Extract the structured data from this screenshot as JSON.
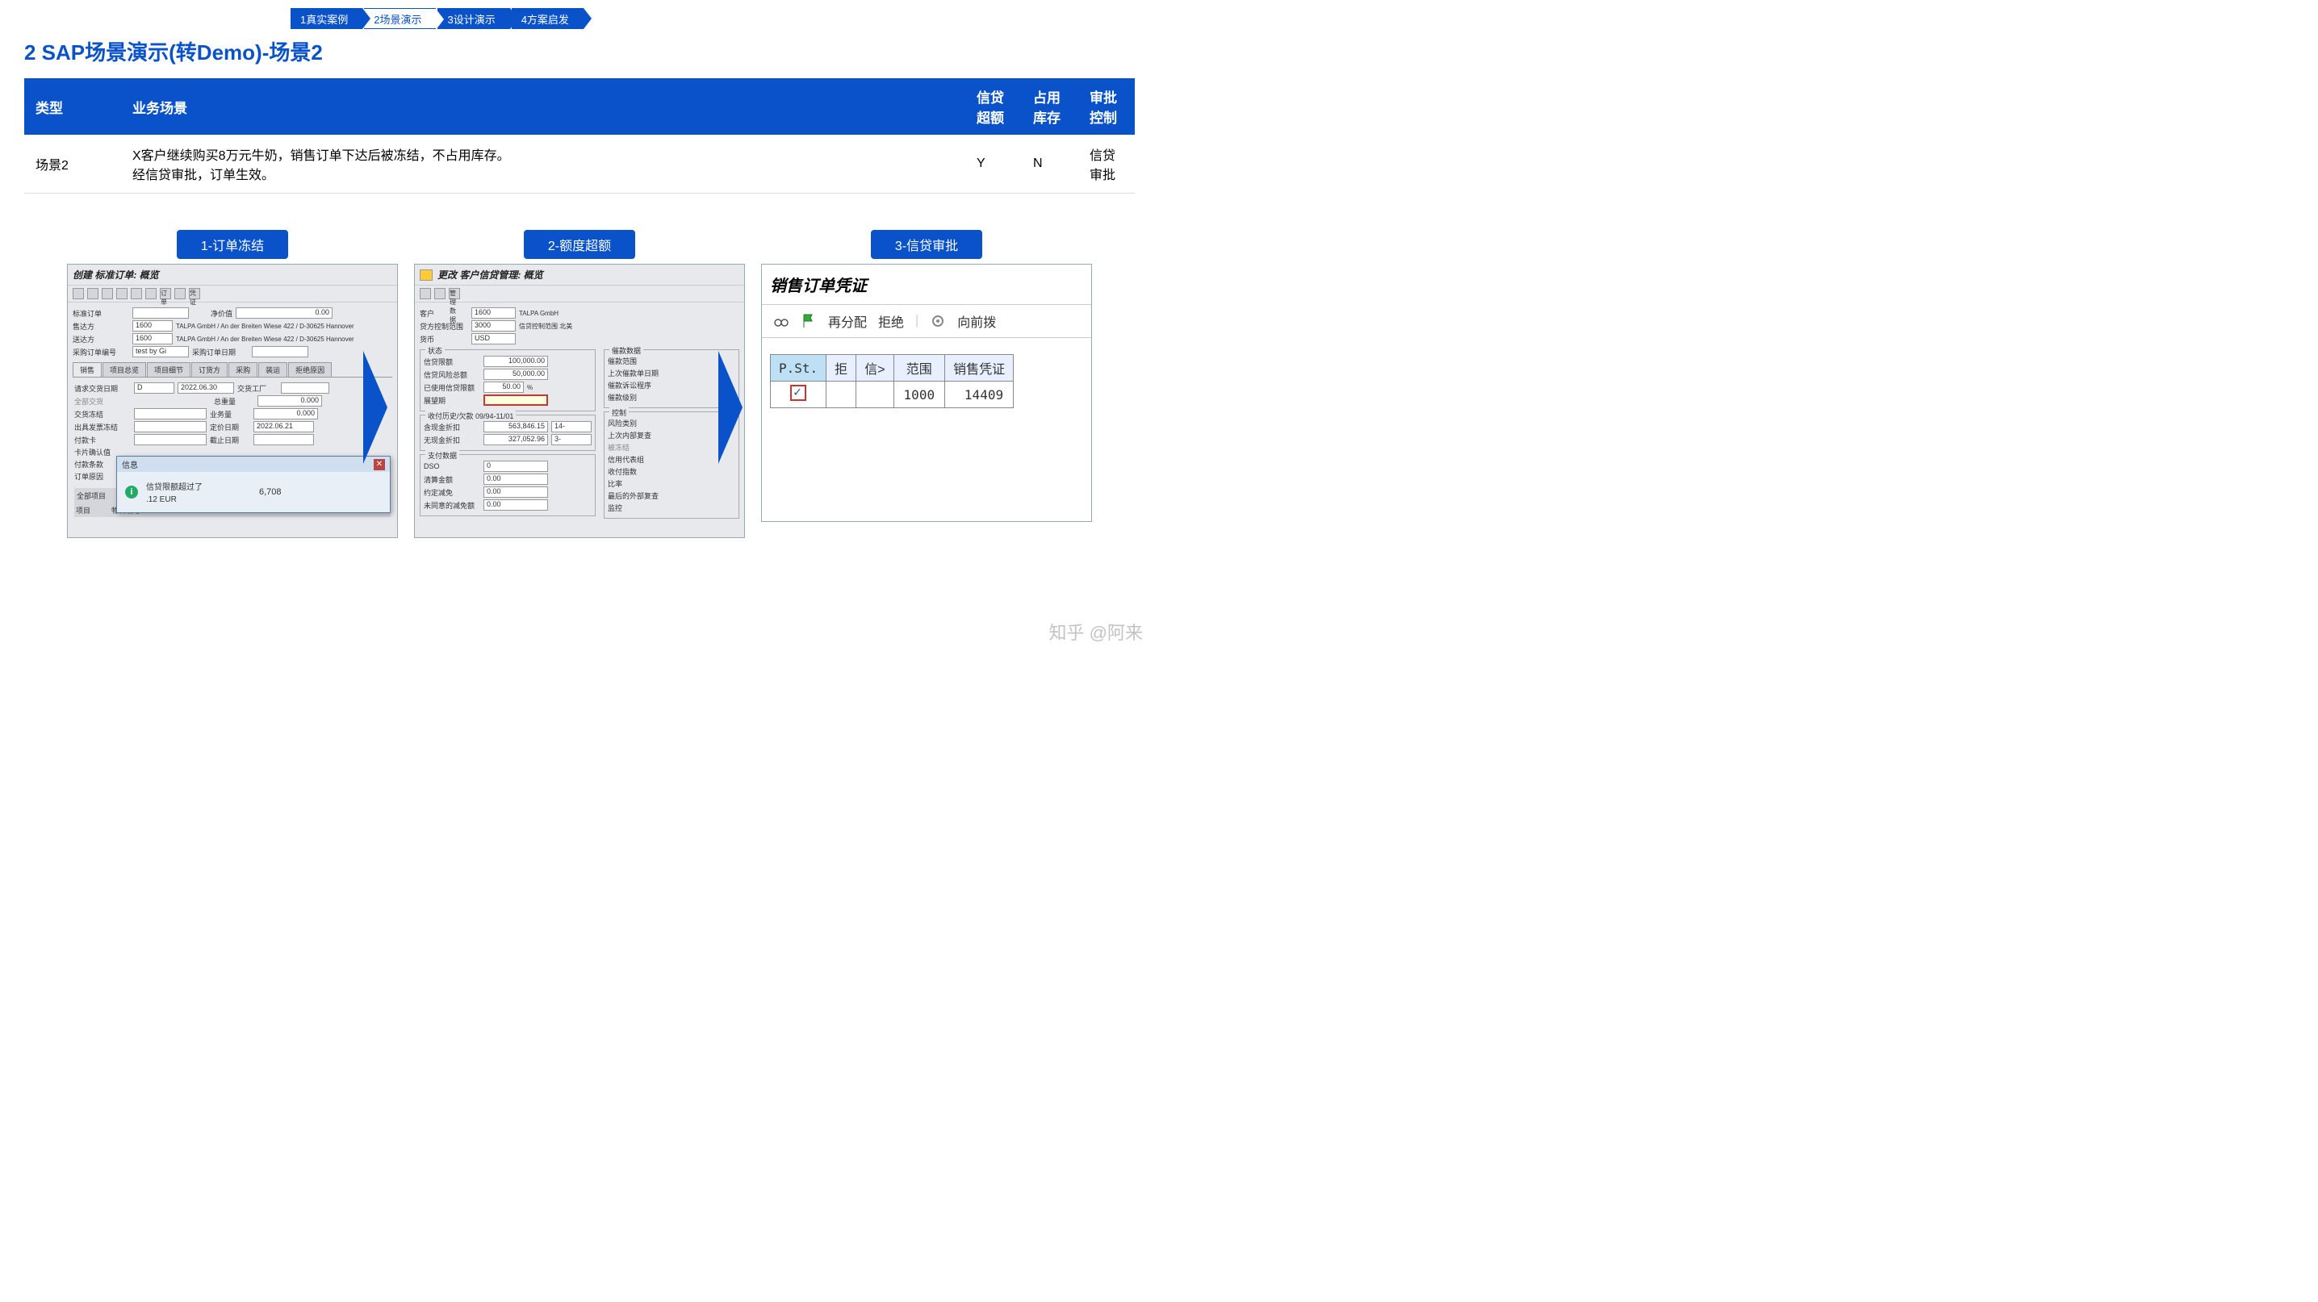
{
  "nav": {
    "n1": "1真实案例",
    "n2": "2场景演示",
    "n3": "3设计演示",
    "n4": "4方案启发"
  },
  "title": "2 SAP场景演示(转Demo)-场景2",
  "table": {
    "headers": {
      "type": "类型",
      "scenario": "业务场景",
      "credit": "信贷\n超额",
      "stock": "占用\n库存",
      "approval": "审批\n控制"
    },
    "row": {
      "type": "场景2",
      "scenario": "X客户继续购买8万元牛奶，销售订单下达后被冻结，不占用库存。\n经信贷审批，订单生效。",
      "credit": "Y",
      "stock": "N",
      "approval": "信贷\n审批"
    }
  },
  "shots": {
    "s1": {
      "label": "1-订单冻结",
      "title": "创建 标准订单: 概览",
      "toolbar_text": "订单",
      "toolbar_text2": "凭证",
      "f_std": "标准订单",
      "f_net": "净价值",
      "v_net": "0.00",
      "f_soldto": "售达方",
      "v_soldto": "1600",
      "t_soldto": "TALPA GmbH / An der Breiten Wiese 422 / D-30625 Hannover",
      "f_shipto": "送达方",
      "v_shipto": "1600",
      "t_shipto": "TALPA GmbH / An der Breiten Wiese 422 / D-30625 Hannover",
      "f_po": "采购订单编号",
      "v_po": "test by Gi",
      "f_podate": "采购订单日期",
      "tabs": [
        "销售",
        "项目总览",
        "项目细节",
        "订货方",
        "采购",
        "装运",
        "拒绝原因"
      ],
      "f_reqdate": "请求交货日期",
      "v_reqdate_t": "D",
      "v_reqdate": "2022.06.30",
      "f_plant": "交货工厂",
      "f_complete": "全部交货",
      "f_weight": "总重量",
      "v_weight": "0.000",
      "f_block": "交货冻结",
      "f_vol": "业务量",
      "v_vol": "0.000",
      "f_billblock": "出具发票冻结",
      "f_pricedate": "定价日期",
      "v_pricedate": "2022.06.21",
      "f_paycard": "付款卡",
      "f_enddate": "截止日期",
      "f_cardconf": "卡片确认值",
      "f_payterm": "付款条款",
      "f_reason": "订单原因",
      "f_allitems": "全部项目",
      "f_item": "项目",
      "f_matno": "物料编号",
      "popup_title": "信息",
      "popup_msg": "信贷限额超过了",
      "popup_val": "6,708",
      "popup_cur": ".12 EUR"
    },
    "s2": {
      "label": "2-额度超额",
      "title": "更改 客户信贷管理: 概览",
      "mgmt": "管理数据",
      "f_cust": "客户",
      "v_cust": "1600",
      "t_cust": "TALPA GmbH",
      "f_area": "贷方控制范围",
      "v_area": "3000",
      "t_area": "信贷控制范围 北美",
      "f_curr": "货币",
      "v_curr": "USD",
      "g_status": "状态",
      "f_limit": "信贷限额",
      "v_limit": "100,000.00",
      "f_risk": "信贷风险总额",
      "v_risk": "50,000.00",
      "f_used": "已使用信贷限额",
      "v_used": "50.00",
      "v_used_u": "%",
      "f_horizon": "展望期",
      "g_dunning": "催款数据",
      "f_dunarea": "催款范围",
      "f_lastdun": "上次催款单日期",
      "f_dunproc": "催款诉讼程序",
      "f_dunlevel": "催款级别",
      "g_history": "收付历史/欠款 09/94-11/01",
      "f_withdisc": "含现金折扣",
      "v_withdisc": "563,846.15",
      "v_wd_n": "14-",
      "f_nodisc": "无现金折扣",
      "v_nodisc": "327,052.96",
      "v_nd_n": "3-",
      "g_control": "控制",
      "f_riskcat": "风险类别",
      "f_lastrev": "上次内部复查",
      "f_frozen": "被冻结",
      "f_group": "信用代表组",
      "f_payindex": "收付指数",
      "f_ratio": "比率",
      "f_lastext": "最后的外部复查",
      "f_monitor": "监控",
      "g_pay": "支付数据",
      "f_dso": "DSO",
      "v_dso": "0",
      "f_clear": "清算金额",
      "v_clear": "0.00",
      "f_agreed": "约定减免",
      "v_agreed": "0.00",
      "f_unagreed": "未同意的减免额",
      "v_unagreed": "0.00"
    },
    "s3": {
      "label": "3-信贷审批",
      "title": "销售订单凭证",
      "btn_realloc": "再分配",
      "btn_reject": "拒绝",
      "btn_forward": "向前拨",
      "th_pst": "P.St.",
      "th_rej": "拒",
      "th_cred": "信>",
      "th_scope": "范围",
      "th_doc": "销售凭证",
      "td_scope": "1000",
      "td_doc": "14409"
    }
  },
  "watermark": "知乎 @阿来"
}
